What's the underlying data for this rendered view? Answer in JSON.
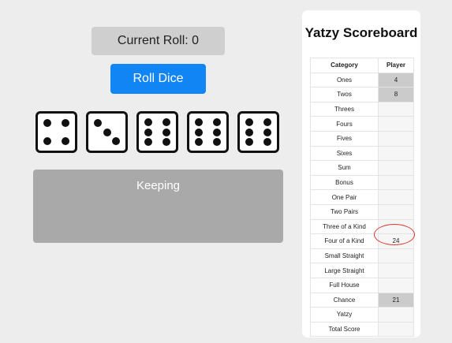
{
  "game": {
    "roll_counter_text": "Current Roll: 0",
    "roll_button_label": "Roll Dice",
    "keeping_label": "Keeping",
    "dice": [
      4,
      3,
      6,
      6,
      6
    ]
  },
  "scoreboard": {
    "title": "Yatzy Scoreboard",
    "headers": {
      "category": "Category",
      "player": "Player"
    },
    "rows": [
      {
        "category": "Ones",
        "score": "4",
        "filled": true
      },
      {
        "category": "Twos",
        "score": "8",
        "filled": true
      },
      {
        "category": "Threes",
        "score": "",
        "filled": false
      },
      {
        "category": "Fours",
        "score": "",
        "filled": false
      },
      {
        "category": "Fives",
        "score": "",
        "filled": false
      },
      {
        "category": "Sixes",
        "score": "",
        "filled": false
      },
      {
        "category": "Sum",
        "score": "",
        "filled": false
      },
      {
        "category": "Bonus",
        "score": "",
        "filled": false
      },
      {
        "category": "One Pair",
        "score": "",
        "filled": false
      },
      {
        "category": "Two Pairs",
        "score": "",
        "filled": false
      },
      {
        "category": "Three of a Kind",
        "score": "",
        "filled": false
      },
      {
        "category": "Four of a Kind",
        "score": "24",
        "filled": false
      },
      {
        "category": "Small Straight",
        "score": "",
        "filled": false
      },
      {
        "category": "Large Straight",
        "score": "",
        "filled": false
      },
      {
        "category": "Full House",
        "score": "",
        "filled": false
      },
      {
        "category": "Chance",
        "score": "21",
        "filled": true
      },
      {
        "category": "Yatzy",
        "score": "",
        "filled": false
      },
      {
        "category": "Total Score",
        "score": "",
        "filled": false
      }
    ]
  },
  "colors": {
    "roll_button": "#1285f5",
    "highlight_ring": "#d63a2e",
    "filled_cell": "#cbcbcb",
    "keeping_area": "#a9a9a9"
  }
}
